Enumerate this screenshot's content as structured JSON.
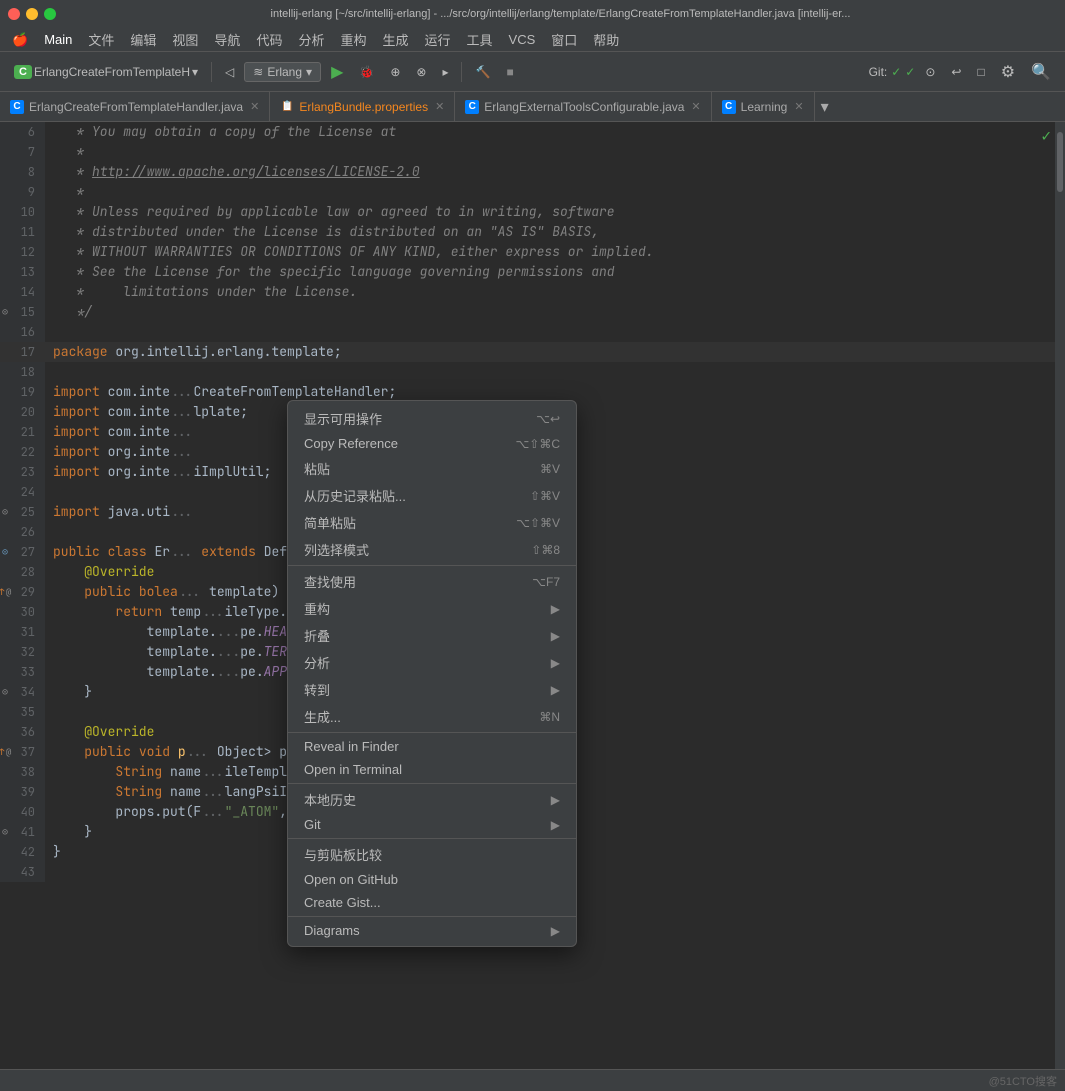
{
  "titleBar": {
    "text": "intellij-erlang [~/src/intellij-erlang] - .../src/org/intellij/erlang/template/ErlangCreateFromTemplateHandler.java [intellij-er..."
  },
  "menuBar": {
    "items": [
      {
        "label": "🍎",
        "id": "apple"
      },
      {
        "label": "Main",
        "id": "main"
      },
      {
        "label": "文件",
        "id": "file"
      },
      {
        "label": "编辑",
        "id": "edit"
      },
      {
        "label": "视图",
        "id": "view"
      },
      {
        "label": "导航",
        "id": "navigate"
      },
      {
        "label": "代码",
        "id": "code"
      },
      {
        "label": "分析",
        "id": "analyze"
      },
      {
        "label": "重构",
        "id": "refactor"
      },
      {
        "label": "生成",
        "id": "build"
      },
      {
        "label": "运行",
        "id": "run"
      },
      {
        "label": "工具",
        "id": "tools"
      },
      {
        "label": "VCS",
        "id": "vcs"
      },
      {
        "label": "窗口",
        "id": "window"
      },
      {
        "label": "帮助",
        "id": "help"
      }
    ]
  },
  "toolbar": {
    "projectLabel": "C",
    "projectName": "ErlangCreateFromTemplateH",
    "erlangDropdown": "Erlang",
    "gitLabel": "Git:",
    "gitStatus1": "✓",
    "gitStatus2": "✓"
  },
  "tabs": [
    {
      "label": "ErlangCreateFromTemplateHandler.java",
      "icon": "C",
      "iconType": "java",
      "active": false,
      "closeable": true
    },
    {
      "label": "ErlangBundle.properties",
      "icon": "📋",
      "iconType": "props",
      "active": false,
      "closeable": true
    },
    {
      "label": "ErlangExternalToolsConfigurable.java",
      "icon": "C",
      "iconType": "java",
      "active": false,
      "closeable": true
    },
    {
      "label": "Learning",
      "icon": "C",
      "iconType": "learning",
      "active": false,
      "closeable": true
    }
  ],
  "codeLines": [
    {
      "ln": "6",
      "content": "   * You may obtain a copy of the License at",
      "type": "comment"
    },
    {
      "ln": "7",
      "content": "   *",
      "type": "comment"
    },
    {
      "ln": "8",
      "content": "   * http://www.apache.org/licenses/LICENSE-2.0",
      "type": "comment-link"
    },
    {
      "ln": "9",
      "content": "   *",
      "type": "comment"
    },
    {
      "ln": "10",
      "content": "   * Unless required by applicable law or agreed to in writing, software",
      "type": "comment"
    },
    {
      "ln": "11",
      "content": "   * distributed under the License is distributed on an \"AS IS\" BASIS,",
      "type": "comment"
    },
    {
      "ln": "12",
      "content": "   * WITHOUT WARRANTIES OR CONDITIONS OF ANY KIND, either express or implied.",
      "type": "comment"
    },
    {
      "ln": "13",
      "content": "   * See the License for the specific language governing permissions and",
      "type": "comment"
    },
    {
      "ln": "14",
      "content": "   *     limitations under the License.",
      "type": "comment"
    },
    {
      "ln": "15",
      "content": "   */",
      "type": "comment"
    },
    {
      "ln": "16",
      "content": "",
      "type": "blank"
    },
    {
      "ln": "17",
      "content": "package org.intellij.erlang.template;",
      "type": "package",
      "highlight": true
    },
    {
      "ln": "18",
      "content": "",
      "type": "blank"
    },
    {
      "ln": "19",
      "content": "import com.inte...CreateFromTemplateHandler;",
      "type": "import"
    },
    {
      "ln": "20",
      "content": "import com.inte...lplate;",
      "type": "import"
    },
    {
      "ln": "21",
      "content": "import com.inte...",
      "type": "import"
    },
    {
      "ln": "22",
      "content": "import org.inte...",
      "type": "import"
    },
    {
      "ln": "23",
      "content": "import org.inte...iImplUtil;",
      "type": "import"
    },
    {
      "ln": "24",
      "content": "",
      "type": "blank"
    },
    {
      "ln": "25",
      "content": "import java.uti...",
      "type": "import"
    },
    {
      "ln": "26",
      "content": "",
      "type": "blank"
    },
    {
      "ln": "27",
      "content": "public class Er... extends DefaultCreateFromTemplateHandler {",
      "type": "class"
    },
    {
      "ln": "28",
      "content": "    @Override",
      "type": "annotation"
    },
    {
      "ln": "29",
      "content": "    public bolea... template) {",
      "type": "method"
    },
    {
      "ln": "30",
      "content": "        return temp...ileType.MODULE) ||",
      "type": "code"
    },
    {
      "ln": "31",
      "content": "            template...pe.HEADER) ||",
      "type": "code"
    },
    {
      "ln": "32",
      "content": "            template...pe.TERMS) ||",
      "type": "code"
    },
    {
      "ln": "33",
      "content": "            template...pe.APP);",
      "type": "code"
    },
    {
      "ln": "34",
      "content": "    }",
      "type": "code"
    },
    {
      "ln": "35",
      "content": "",
      "type": "blank"
    },
    {
      "ln": "36",
      "content": "    @Override",
      "type": "annotation"
    },
    {
      "ln": "37",
      "content": "    public void p... Object> props) {",
      "type": "method"
    },
    {
      "ln": "38",
      "content": "        String name...ileTemplate.ATTRIBUTE_NAME));",
      "type": "code"
    },
    {
      "ln": "39",
      "content": "        String name...langPsiImplUtil.toAtomName(name), name);",
      "type": "code"
    },
    {
      "ln": "40",
      "content": "        props.put(F...\"_ATOM\", nameAtom);",
      "type": "code"
    },
    {
      "ln": "41",
      "content": "    }",
      "type": "code"
    },
    {
      "ln": "42",
      "content": "}",
      "type": "code"
    },
    {
      "ln": "43",
      "content": "",
      "type": "blank"
    }
  ],
  "contextMenu": {
    "items": [
      {
        "label": "显示可用操作",
        "shortcut": "⌥↩",
        "hasSubmenu": false,
        "type": "item"
      },
      {
        "label": "Copy Reference",
        "shortcut": "⌥⇧⌘C",
        "hasSubmenu": false,
        "type": "item"
      },
      {
        "label": "粘贴",
        "shortcut": "⌘V",
        "hasSubmenu": false,
        "type": "item"
      },
      {
        "label": "从历史记录粘贴...",
        "shortcut": "⇧⌘V",
        "hasSubmenu": false,
        "type": "item"
      },
      {
        "label": "简单粘贴",
        "shortcut": "⌥⇧⌘V",
        "hasSubmenu": false,
        "type": "item"
      },
      {
        "label": "列选择模式",
        "shortcut": "⇧⌘8",
        "hasSubmenu": false,
        "type": "item"
      },
      {
        "type": "separator"
      },
      {
        "label": "查找使用",
        "shortcut": "⌥F7",
        "hasSubmenu": false,
        "type": "item"
      },
      {
        "label": "重构",
        "shortcut": "",
        "hasSubmenu": true,
        "type": "item"
      },
      {
        "label": "折叠",
        "shortcut": "",
        "hasSubmenu": true,
        "type": "item"
      },
      {
        "label": "分析",
        "shortcut": "",
        "hasSubmenu": true,
        "type": "item"
      },
      {
        "label": "转到",
        "shortcut": "",
        "hasSubmenu": true,
        "type": "item"
      },
      {
        "label": "生成...",
        "shortcut": "⌘N",
        "hasSubmenu": false,
        "type": "item"
      },
      {
        "type": "separator"
      },
      {
        "label": "Reveal in Finder",
        "shortcut": "",
        "hasSubmenu": false,
        "type": "item"
      },
      {
        "label": "Open in Terminal",
        "shortcut": "",
        "hasSubmenu": false,
        "type": "item"
      },
      {
        "type": "separator"
      },
      {
        "label": "本地历史",
        "shortcut": "",
        "hasSubmenu": true,
        "type": "item"
      },
      {
        "label": "Git",
        "shortcut": "",
        "hasSubmenu": true,
        "type": "item"
      },
      {
        "type": "separator"
      },
      {
        "label": "与剪贴板比较",
        "shortcut": "",
        "hasSubmenu": false,
        "type": "item"
      },
      {
        "label": "Open on GitHub",
        "shortcut": "",
        "hasSubmenu": false,
        "type": "item"
      },
      {
        "label": "Create Gist...",
        "shortcut": "",
        "hasSubmenu": false,
        "type": "item"
      },
      {
        "type": "separator"
      },
      {
        "label": "Diagrams",
        "shortcut": "",
        "hasSubmenu": true,
        "type": "item"
      }
    ]
  },
  "statusBar": {
    "watermark": "@51CTO搜客"
  }
}
